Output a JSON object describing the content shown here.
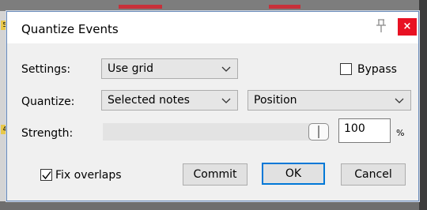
{
  "background": {
    "ruler_labels": [
      "5",
      "4"
    ]
  },
  "dialog": {
    "title": "Quantize Events",
    "pin_icon": "pin-icon",
    "close_glyph": "×",
    "settings": {
      "label": "Settings:",
      "value": "Use grid"
    },
    "bypass": {
      "label": "Bypass",
      "checked": false
    },
    "quantize": {
      "label": "Quantize:",
      "value": "Selected notes",
      "mode_value": "Position"
    },
    "strength": {
      "label": "Strength:",
      "value": "100",
      "unit": "%",
      "level": 1.0
    },
    "fix_overlaps": {
      "label": "Fix overlaps",
      "checked": true
    },
    "buttons": {
      "commit": "Commit",
      "ok": "OK",
      "cancel": "Cancel"
    }
  }
}
